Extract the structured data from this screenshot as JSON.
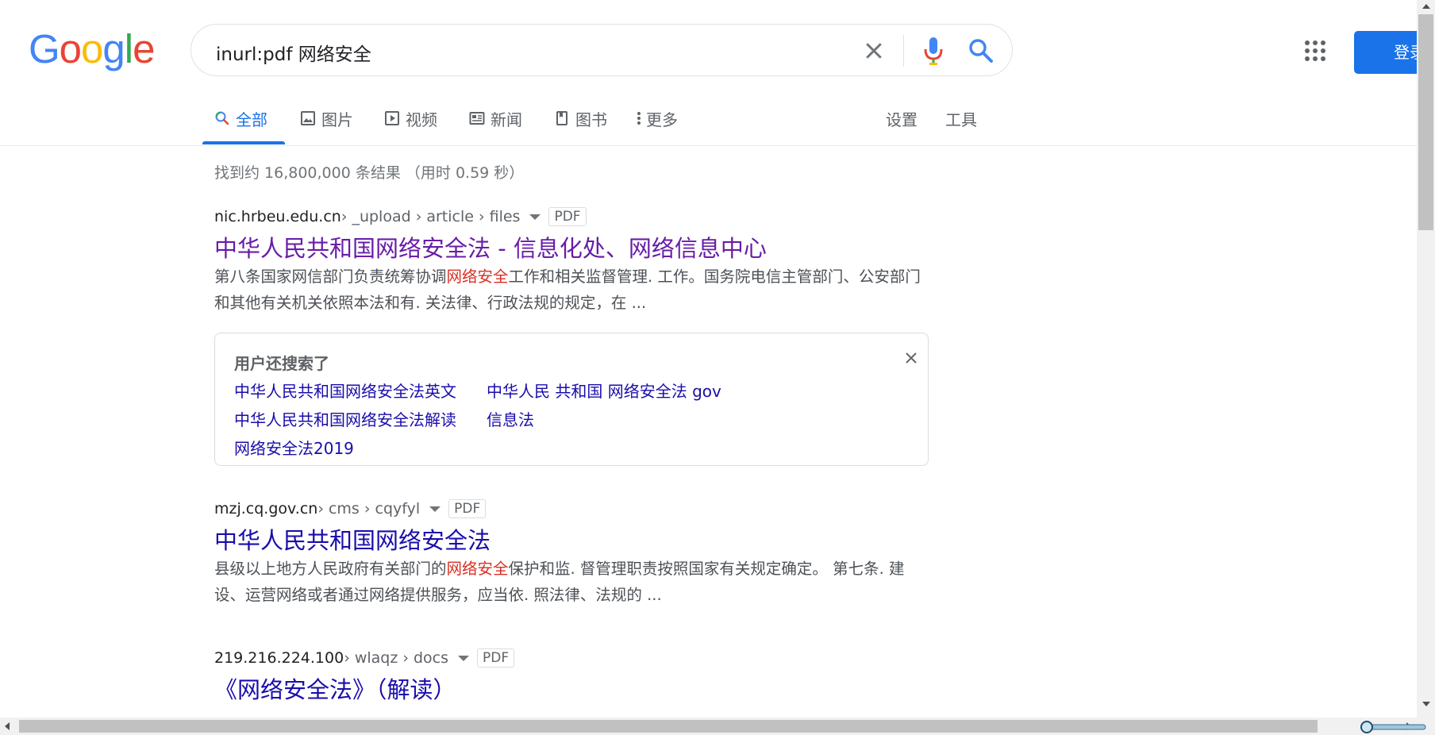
{
  "header": {
    "logo_letters": [
      {
        "ch": "G",
        "color": "#4285F4"
      },
      {
        "ch": "o",
        "color": "#EA4335"
      },
      {
        "ch": "o",
        "color": "#FBBC05"
      },
      {
        "ch": "g",
        "color": "#4285F4"
      },
      {
        "ch": "l",
        "color": "#34A853"
      },
      {
        "ch": "e",
        "color": "#EA4335"
      }
    ],
    "search_query": "inurl:pdf 网络安全",
    "signin_label": "登录",
    "icons": [
      "clear-icon",
      "mic-icon",
      "search-icon",
      "apps-icon"
    ]
  },
  "tabs": [
    {
      "label": "全部",
      "icon": "search-icon",
      "active": true
    },
    {
      "label": "图片",
      "icon": "image-icon"
    },
    {
      "label": "视频",
      "icon": "video-icon"
    },
    {
      "label": "新闻",
      "icon": "news-icon"
    },
    {
      "label": "图书",
      "icon": "book-icon"
    },
    {
      "label": "更多",
      "icon": "more-vert-icon"
    },
    {
      "label": "设置"
    },
    {
      "label": "工具"
    }
  ],
  "stats": "找到约 16,800,000 条结果  （用时 0.59 秒） ",
  "results": [
    {
      "domain": "nic.hrbeu.edu.cn",
      "path": " › _upload › article › files",
      "badge": "PDF",
      "title": "中华人民共和国网络安全法 - 信息化处、网络信息中心",
      "snippet_pre": "第八条国家网信部门负责统筹协调",
      "snippet_em": "网络安全",
      "snippet_post": "工作和相关监督管理. 工作。国务院电信主管部门、公安部门和其他有关机关依照本法和有. 关法律、行政法规的规定，在 ..."
    },
    {
      "domain": "mzj.cq.gov.cn",
      "path": " › cms › cqyfyl",
      "badge": "PDF",
      "title": "中华人民共和国网络安全法",
      "snippet_pre": "县级以上地方人民政府有关部门的",
      "snippet_em": "网络安全",
      "snippet_post": "保护和监. 督管理职责按照国家有关规定确定。 第七条. 建设、运营网络或者通过网络提供服务，应当依. 照法律、法规的 ..."
    },
    {
      "domain": "219.216.224.100",
      "path": " › wlaqz › docs",
      "badge": "PDF",
      "title": "《网络安全法》（解读）"
    }
  ],
  "people_also_search": {
    "heading": "用户还搜索了",
    "links": [
      "中华人民共和国网络安全法英文",
      "中华人民 共和国 网络安全法 gov",
      "中华人民共和国网络安全法解读",
      "信息法",
      "网络安全法2019"
    ]
  }
}
